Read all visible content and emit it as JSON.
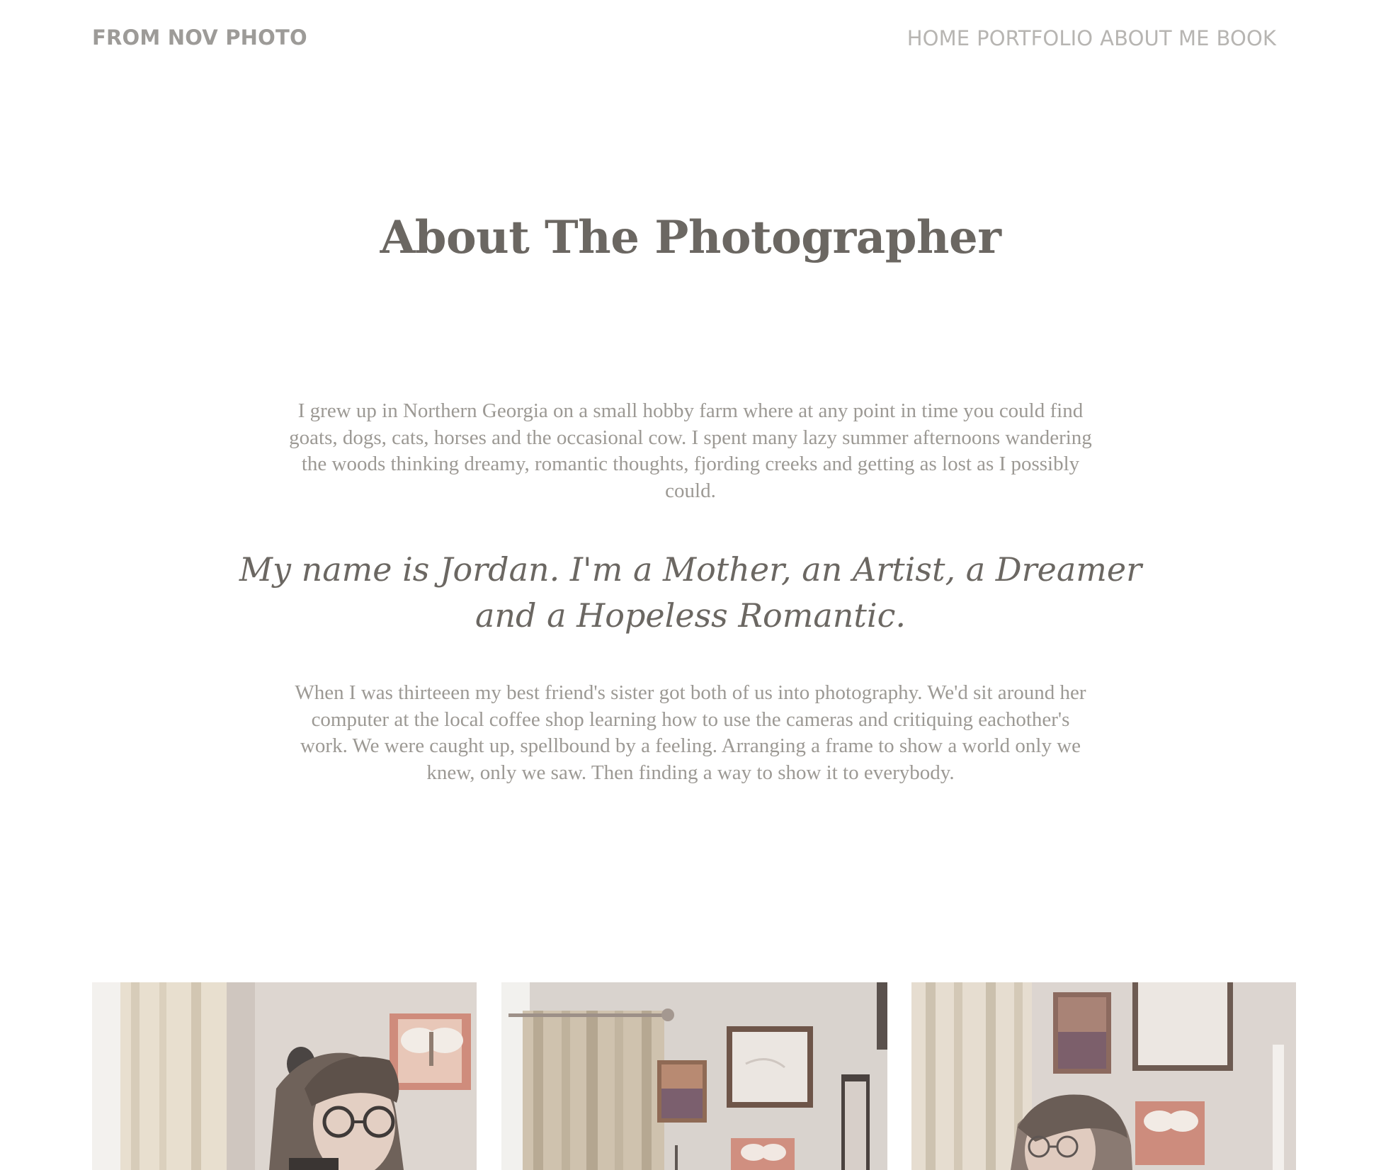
{
  "header": {
    "brand": "FROM NOV PHOTO",
    "nav": [
      {
        "label": "HOME"
      },
      {
        "label": "PORTFOLIO"
      },
      {
        "label": "ABOUT ME"
      },
      {
        "label": "BOOK"
      }
    ]
  },
  "main": {
    "title": "About The Photographer",
    "intro": "I grew up in Northern Georgia on a small hobby farm where at any point in time you could find goats, dogs, cats, horses and the occasional cow. I spent many lazy summer afternoons wandering the woods thinking dreamy, romantic thoughts, fjording creeks and getting as lost as I possibly could.",
    "tagline": "My name is Jordan. I'm a Mother, an Artist, a Dreamer and a Hopeless Romantic.",
    "story": "When I was thirteeen my best friend's sister got both of us into photography. We'd sit around her computer at the local coffee shop learning how to use the cameras and critiquing eachother's work. We were caught up, spellbound by a feeling. Arranging a frame to show a world only we knew, only we saw. Then finding a way to show it to everybody."
  },
  "gallery": {
    "photos": [
      {
        "subject": "photographer-portrait-with-camera"
      },
      {
        "subject": "living-room-wall-with-art"
      },
      {
        "subject": "photographer-portrait-glasses"
      }
    ]
  },
  "colors": {
    "brand": "#9d9b98",
    "nav": "#b7b5b2",
    "heading": "#6b6762",
    "body_text": "#9c9994",
    "background": "#ffffff"
  }
}
